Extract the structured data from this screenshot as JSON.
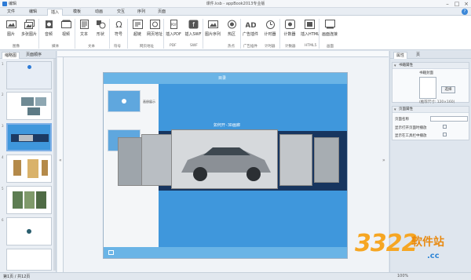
{
  "window": {
    "app_label": "编辑",
    "title": "课件.ksb - appBook2013专业版",
    "controls": [
      "–",
      "□",
      "×"
    ]
  },
  "ribbon_tabs": [
    "文件",
    "编辑",
    "插入",
    "模板",
    "动画",
    "交互",
    "序列",
    "页面"
  ],
  "active_tab": "插入",
  "ribbon_buttons": [
    {
      "label": "图片",
      "icon": "image-icon"
    },
    {
      "label": "多张图片",
      "icon": "images-icon"
    },
    {
      "label": "音频",
      "icon": "audio-icon"
    },
    {
      "label": "视频",
      "icon": "video-icon"
    },
    {
      "label": "文本",
      "icon": "text-icon"
    },
    {
      "label": "形状",
      "icon": "shape-icon"
    },
    {
      "label": "符号",
      "icon": "omega-icon"
    },
    {
      "label": "超链",
      "icon": "link-icon"
    },
    {
      "label": "网页地址",
      "icon": "web-icon"
    },
    {
      "label": "插入PDF",
      "icon": "pdf-icon"
    },
    {
      "label": "插入SWF",
      "icon": "swf-icon"
    },
    {
      "label": "图片序列",
      "icon": "sequence-icon"
    },
    {
      "label": "热区",
      "icon": "hotspot-icon"
    },
    {
      "label": "广告插件",
      "icon": "ad-icon"
    },
    {
      "label": "计时器",
      "icon": "timer-icon"
    },
    {
      "label": "计数器",
      "icon": "counter-icon"
    },
    {
      "label": "插入HTML",
      "icon": "html-icon"
    },
    {
      "label": "画面连接",
      "icon": "connect-icon"
    }
  ],
  "ribbon_groups": [
    "图像",
    "媒体",
    "文本",
    "符号",
    "网页地址",
    "PDF",
    "SWF",
    "热点",
    "广告插件",
    "计时器",
    "计数器",
    "HTML5",
    "画面"
  ],
  "left_panel": {
    "tabs": [
      "缩略图",
      "页面顺序"
    ],
    "pages": [
      "1",
      "2",
      "3",
      "4",
      "5",
      "6"
    ]
  },
  "slide": {
    "header_text": "目录",
    "title": "如何开-3D画廊",
    "thumb_label": "画册展示"
  },
  "right_panel": {
    "tabs": [
      "属性",
      "页"
    ],
    "section1": {
      "title": "书籍属性",
      "image_label": "书籍封面",
      "select_button": "选择",
      "size_hint": "(推荐尺寸: 120×160)"
    },
    "section2": {
      "title": "页面属性",
      "page_name_label": "页面名称",
      "option1": "显示打开页面时播放",
      "option2": "显示在工具栏中播放"
    }
  },
  "status": {
    "page": "第1页 / 共12页",
    "zoom": "100%"
  },
  "watermark": {
    "number": "3322",
    "cn": "软件站",
    "domain": ".cc"
  }
}
